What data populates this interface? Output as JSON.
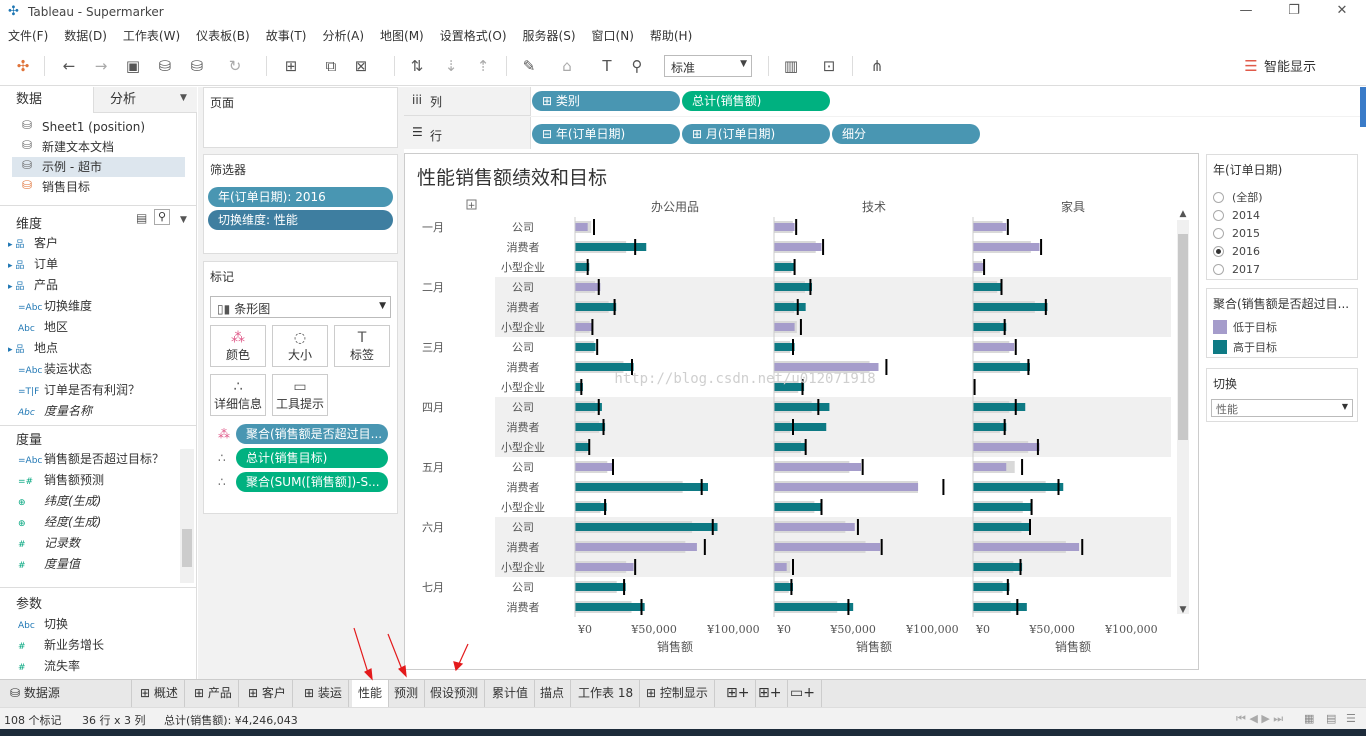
{
  "window": {
    "title": "Tableau - Supermarker",
    "minimize": "—",
    "restore": "❐",
    "close": "✕"
  },
  "menu": [
    "文件(F)",
    "数据(D)",
    "工作表(W)",
    "仪表板(B)",
    "故事(T)",
    "分析(A)",
    "地图(M)",
    "设置格式(O)",
    "服务器(S)",
    "窗口(N)",
    "帮助(H)"
  ],
  "toolbar": {
    "fit_select": "标准",
    "smart_show": "智能显示"
  },
  "left_pane": {
    "tabs": [
      "数据",
      "分析"
    ],
    "datasources": [
      "Sheet1 (position)",
      "新建文本文档",
      "示例 - 超市",
      "销售目标"
    ],
    "dimensions_header": "维度",
    "dimensions": [
      {
        "icon": "▸ 品",
        "label": "客户"
      },
      {
        "icon": "▸ 品",
        "label": "订单"
      },
      {
        "icon": "▸ 品",
        "label": "产品"
      },
      {
        "icon": "=Abc",
        "label": "切换维度"
      },
      {
        "icon": "Abc",
        "label": "地区"
      },
      {
        "icon": "▸ 品",
        "label": "地点"
      },
      {
        "icon": "=Abc",
        "label": "装运状态"
      },
      {
        "icon": "=T|F",
        "label": "订单是否有利润？"
      },
      {
        "icon": "Abc",
        "label": "度量名称"
      }
    ],
    "measures_header": "度量",
    "measures": [
      {
        "icon": "=Abc",
        "label": "销售额是否超过目标？"
      },
      {
        "icon": "=#",
        "label": "销售额预测"
      },
      {
        "icon": "⊕",
        "label": "纬度(生成)"
      },
      {
        "icon": "⊕",
        "label": "经度(生成)"
      },
      {
        "icon": "#",
        "label": "记录数"
      },
      {
        "icon": "#",
        "label": "度量值"
      }
    ],
    "params_header": "参数",
    "params": [
      {
        "icon": "Abc",
        "label": "切换"
      },
      {
        "icon": "#",
        "label": "新业务增长"
      },
      {
        "icon": "#",
        "label": "流失率"
      }
    ]
  },
  "shelves": {
    "pages": "页面",
    "filters": "筛选器",
    "filter_pills": [
      "年(订单日期): 2016",
      "切换维度: 性能"
    ],
    "marks": "标记",
    "mark_type": "条形图",
    "mark_buttons": [
      "颜色",
      "大小",
      "标签",
      "详细信息",
      "工具提示"
    ],
    "mark_pills": [
      "聚合(销售额是否超过目...",
      "总计(销售目标)",
      "聚合(SUM([销售额])-S..."
    ],
    "columns_label": "列",
    "rows_label": "行",
    "column_pills": [
      "类别",
      "总计(销售额)"
    ],
    "row_pills": [
      "年(订单日期)",
      "月(订单日期)",
      "细分"
    ]
  },
  "view": {
    "title": "性能销售额绩效和目标",
    "watermark": "http://blog.csdn.net/u012071918"
  },
  "chart_data": {
    "type": "bar",
    "title": "性能销售额绩效和目标",
    "panels": [
      "办公用品",
      "技术",
      "家具"
    ],
    "months": [
      "一月",
      "二月",
      "三月",
      "四月",
      "五月",
      "六月",
      "七月"
    ],
    "segments": [
      "公司",
      "消费者",
      "小型企业"
    ],
    "xlabel": "销售额",
    "xticks": [
      "¥0",
      "¥50,000",
      "¥100,000"
    ],
    "xlim": [
      0,
      120000
    ],
    "legend": {
      "below": "低于目标",
      "above": "高于目标"
    },
    "colors": {
      "below": "#a59ccb",
      "above": "#0e7a84",
      "target_band": "#d9d9d9",
      "target_line": "#000000",
      "band_row": "#f0f0f0"
    },
    "rows": [
      {
        "m": 0,
        "s": 0,
        "v": [
          [
            8000,
            0,
            12000
          ],
          [
            13000,
            0,
            14000
          ],
          [
            21000,
            0,
            22000
          ]
        ]
      },
      {
        "m": 0,
        "s": 1,
        "v": [
          [
            45000,
            1,
            38000
          ],
          [
            30000,
            0,
            31000
          ],
          [
            42000,
            0,
            43000
          ]
        ]
      },
      {
        "m": 0,
        "s": 2,
        "v": [
          [
            9000,
            1,
            8000
          ],
          [
            13000,
            1,
            13000
          ],
          [
            7000,
            0,
            7000
          ]
        ]
      },
      {
        "m": 1,
        "s": 0,
        "v": [
          [
            16000,
            0,
            15000
          ],
          [
            24000,
            1,
            23000
          ],
          [
            18000,
            1,
            18000
          ]
        ]
      },
      {
        "m": 1,
        "s": 1,
        "v": [
          [
            26000,
            1,
            25000
          ],
          [
            20000,
            1,
            15000
          ],
          [
            47000,
            1,
            46000
          ]
        ]
      },
      {
        "m": 1,
        "s": 2,
        "v": [
          [
            11000,
            0,
            11000
          ],
          [
            13000,
            0,
            17000
          ],
          [
            21000,
            1,
            20000
          ]
        ]
      },
      {
        "m": 2,
        "s": 0,
        "v": [
          [
            13000,
            1,
            14000
          ],
          [
            13000,
            1,
            12000
          ],
          [
            26000,
            0,
            27000
          ]
        ]
      },
      {
        "m": 2,
        "s": 1,
        "v": [
          [
            37000,
            1,
            36000
          ],
          [
            66000,
            0,
            71000
          ],
          [
            36000,
            1,
            35000
          ]
        ]
      },
      {
        "m": 2,
        "s": 2,
        "v": [
          [
            5000,
            1,
            4000
          ],
          [
            19000,
            1,
            18000
          ],
          [
            0,
            0,
            1000
          ]
        ]
      },
      {
        "m": 3,
        "s": 0,
        "v": [
          [
            17000,
            1,
            15000
          ],
          [
            35000,
            1,
            28000
          ],
          [
            33000,
            1,
            27000
          ]
        ]
      },
      {
        "m": 3,
        "s": 1,
        "v": [
          [
            19000,
            1,
            18000
          ],
          [
            33000,
            1,
            12000
          ],
          [
            21000,
            1,
            20000
          ]
        ]
      },
      {
        "m": 3,
        "s": 2,
        "v": [
          [
            9000,
            1,
            9000
          ],
          [
            20000,
            1,
            20000
          ],
          [
            42000,
            0,
            41000
          ]
        ]
      },
      {
        "m": 4,
        "s": 0,
        "v": [
          [
            24000,
            0,
            24000
          ],
          [
            55000,
            0,
            56000
          ],
          [
            21000,
            0,
            31000
          ]
        ]
      },
      {
        "m": 4,
        "s": 1,
        "v": [
          [
            84000,
            1,
            80000
          ],
          [
            91000,
            0,
            107000
          ],
          [
            57000,
            1,
            54000
          ]
        ]
      },
      {
        "m": 4,
        "s": 2,
        "v": [
          [
            20000,
            1,
            19000
          ],
          [
            30000,
            1,
            30000
          ],
          [
            37000,
            1,
            37000
          ]
        ]
      },
      {
        "m": 5,
        "s": 0,
        "v": [
          [
            90000,
            1,
            87000
          ],
          [
            51000,
            0,
            53000
          ],
          [
            36000,
            1,
            36000
          ]
        ]
      },
      {
        "m": 5,
        "s": 1,
        "v": [
          [
            77000,
            0,
            82000
          ],
          [
            67000,
            0,
            68000
          ],
          [
            67000,
            0,
            69000
          ]
        ]
      },
      {
        "m": 5,
        "s": 2,
        "v": [
          [
            37000,
            0,
            38000
          ],
          [
            8000,
            0,
            12000
          ],
          [
            31000,
            1,
            30000
          ]
        ]
      },
      {
        "m": 6,
        "s": 0,
        "v": [
          [
            32000,
            1,
            31000
          ],
          [
            12000,
            1,
            11000
          ],
          [
            23000,
            1,
            22000
          ]
        ]
      },
      {
        "m": 6,
        "s": 1,
        "v": [
          [
            44000,
            1,
            42000
          ],
          [
            50000,
            1,
            47000
          ],
          [
            34000,
            1,
            28000
          ]
        ]
      }
    ]
  },
  "right_pane": {
    "year_filter_title": "年(订单日期)",
    "year_options": [
      "(全部)",
      "2014",
      "2015",
      "2016",
      "2017"
    ],
    "year_selected": "2016",
    "color_legend_title": "聚合(销售额是否超过目...",
    "color_legend": [
      "低于目标",
      "高于目标"
    ],
    "param_title": "切换",
    "param_value": "性能"
  },
  "sheet_tabs": [
    "数据源",
    "概述",
    "产品",
    "客户",
    "装运",
    "性能",
    "预测",
    "假设预测",
    "累计值",
    "描点",
    "工作表 18",
    "控制显示"
  ],
  "active_tab": "性能",
  "status": {
    "marks": "108 个标记",
    "dims": "36 行 x 3 列",
    "sum": "总计(销售额): ¥4,246,043"
  }
}
